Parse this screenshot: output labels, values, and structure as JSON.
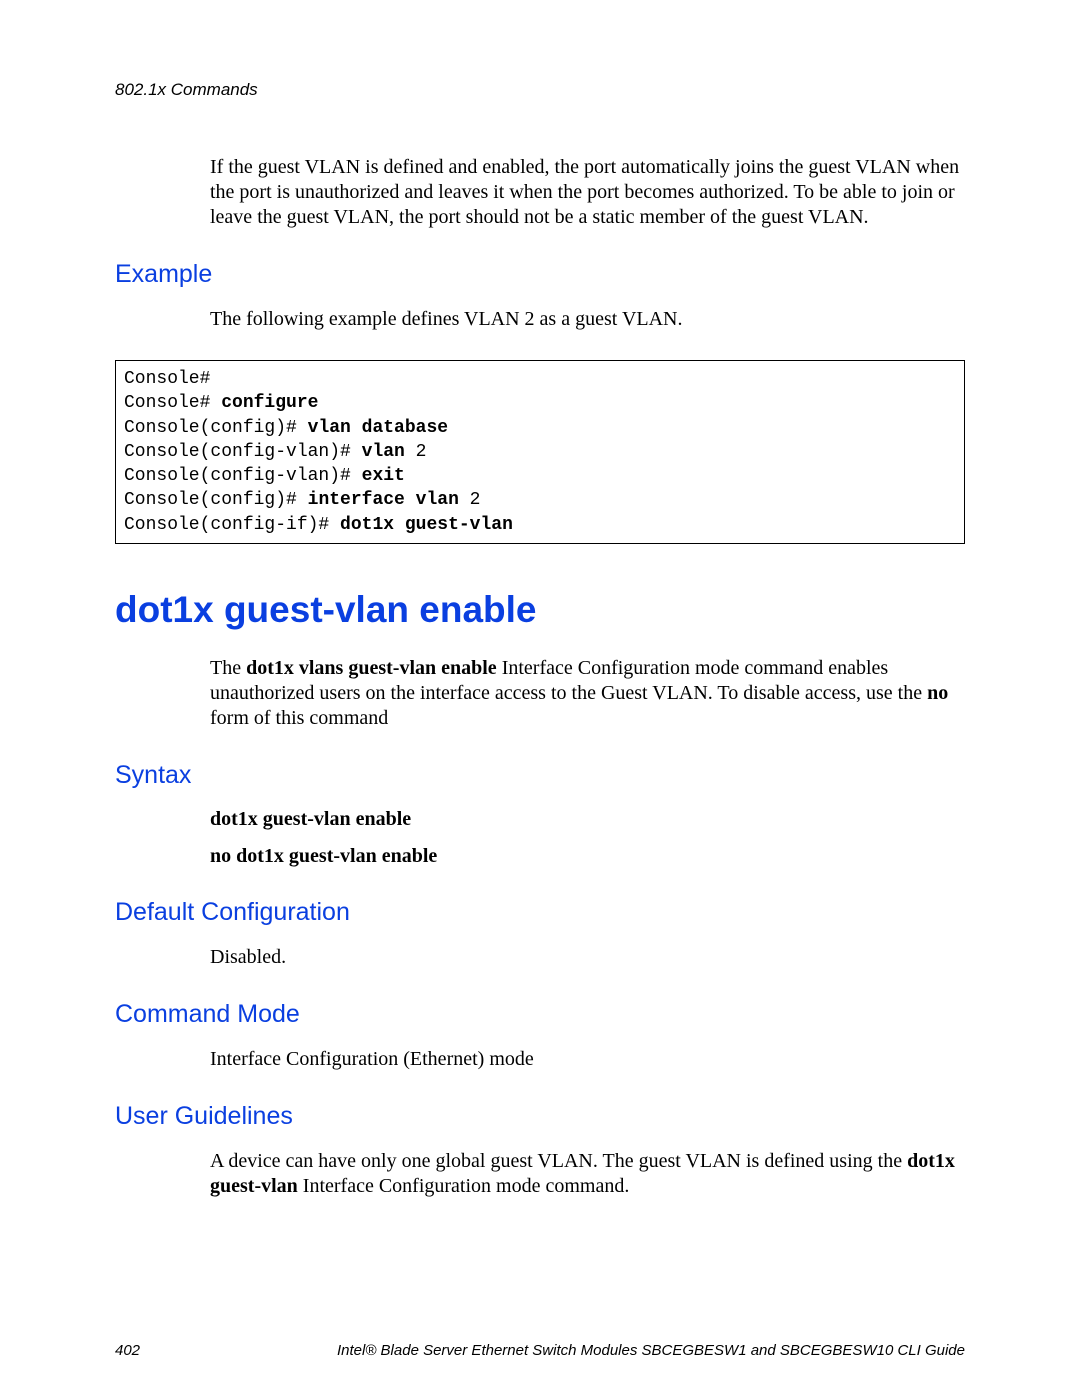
{
  "header": {
    "running_title": "802.1x Commands"
  },
  "intro_para": "If the guest VLAN is defined and enabled, the port automatically joins the guest VLAN when the port is unauthorized and leaves it when the port becomes authorized. To be able to join or leave the guest VLAN, the port should not be a static member of the guest VLAN.",
  "example": {
    "heading": "Example",
    "lead": "The following example defines VLAN 2 as a guest VLAN.",
    "code": [
      {
        "prompt": "Console#",
        "cmd": ""
      },
      {
        "prompt": "Console# ",
        "cmd": "configure"
      },
      {
        "prompt": "Console(config)# ",
        "cmd": "vlan database"
      },
      {
        "prompt": "Console(config-vlan)# ",
        "cmd": "vlan",
        "tail": " 2"
      },
      {
        "prompt": "Console(config-vlan)# ",
        "cmd": "exit"
      },
      {
        "prompt": "Console(config)# ",
        "cmd": "interface vlan",
        "tail": " 2"
      },
      {
        "prompt": "Console(config-if)# ",
        "cmd": "dot1x guest-vlan"
      }
    ]
  },
  "command": {
    "title": "dot1x guest-vlan enable",
    "desc_pre": "The ",
    "desc_bold1": "dot1x vlans guest-vlan enable",
    "desc_mid": " Interface Configuration mode command enables unauthorized users on the interface access to the Guest VLAN. To disable access, use the ",
    "desc_bold2": "no",
    "desc_post": " form of this command"
  },
  "syntax": {
    "heading": "Syntax",
    "line1": "dot1x guest-vlan enable",
    "line2": "no dot1x guest-vlan enable"
  },
  "default_cfg": {
    "heading": "Default Configuration",
    "text": "Disabled."
  },
  "cmd_mode": {
    "heading": "Command Mode",
    "text": "Interface Configuration (Ethernet) mode"
  },
  "guidelines": {
    "heading": "User Guidelines",
    "pre": "A device can have only one global guest VLAN. The guest VLAN is defined using the ",
    "bold": "dot1x guest-vlan",
    "post": " Interface Configuration mode command."
  },
  "footer": {
    "page": "402",
    "title": "Intel® Blade Server Ethernet Switch Modules SBCEGBESW1 and SBCEGBESW10 CLI Guide"
  }
}
